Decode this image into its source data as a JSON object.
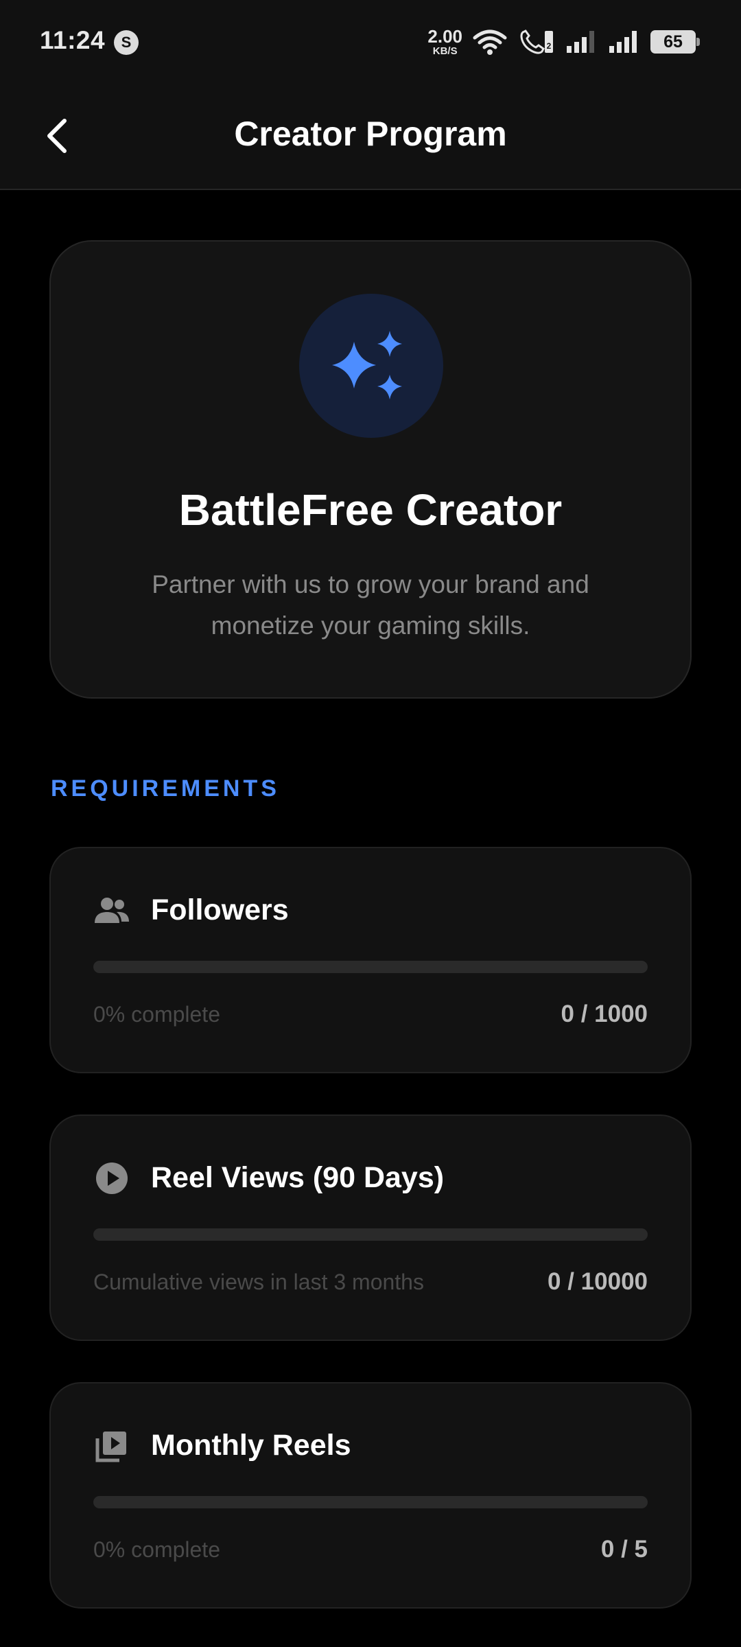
{
  "status_bar": {
    "time": "11:24",
    "app_icon_glyph": "S",
    "net_speed_value": "2.00",
    "net_speed_unit": "KB/S",
    "battery": "65"
  },
  "app_bar": {
    "title": "Creator Program",
    "back_icon": "chevron-left-icon"
  },
  "hero": {
    "icon": "sparkles-icon",
    "title": "BattleFree Creator",
    "subtitle": "Partner with us to grow your brand and monetize your gaming skills."
  },
  "requirements": {
    "heading": "REQUIREMENTS",
    "items": [
      {
        "icon": "people-icon",
        "title": "Followers",
        "note": "0% complete",
        "count": "0 / 1000",
        "progress": 0
      },
      {
        "icon": "play-circle-icon",
        "title": "Reel Views (90 Days)",
        "note": "Cumulative views in last 3 months",
        "count": "0 / 10000",
        "progress": 0
      },
      {
        "icon": "video-library-icon",
        "title": "Monthly Reels",
        "note": "0% complete",
        "count": "0 / 5",
        "progress": 0
      }
    ]
  },
  "colors": {
    "accent": "#4d8dff",
    "background": "#000000",
    "card": "#121212"
  }
}
